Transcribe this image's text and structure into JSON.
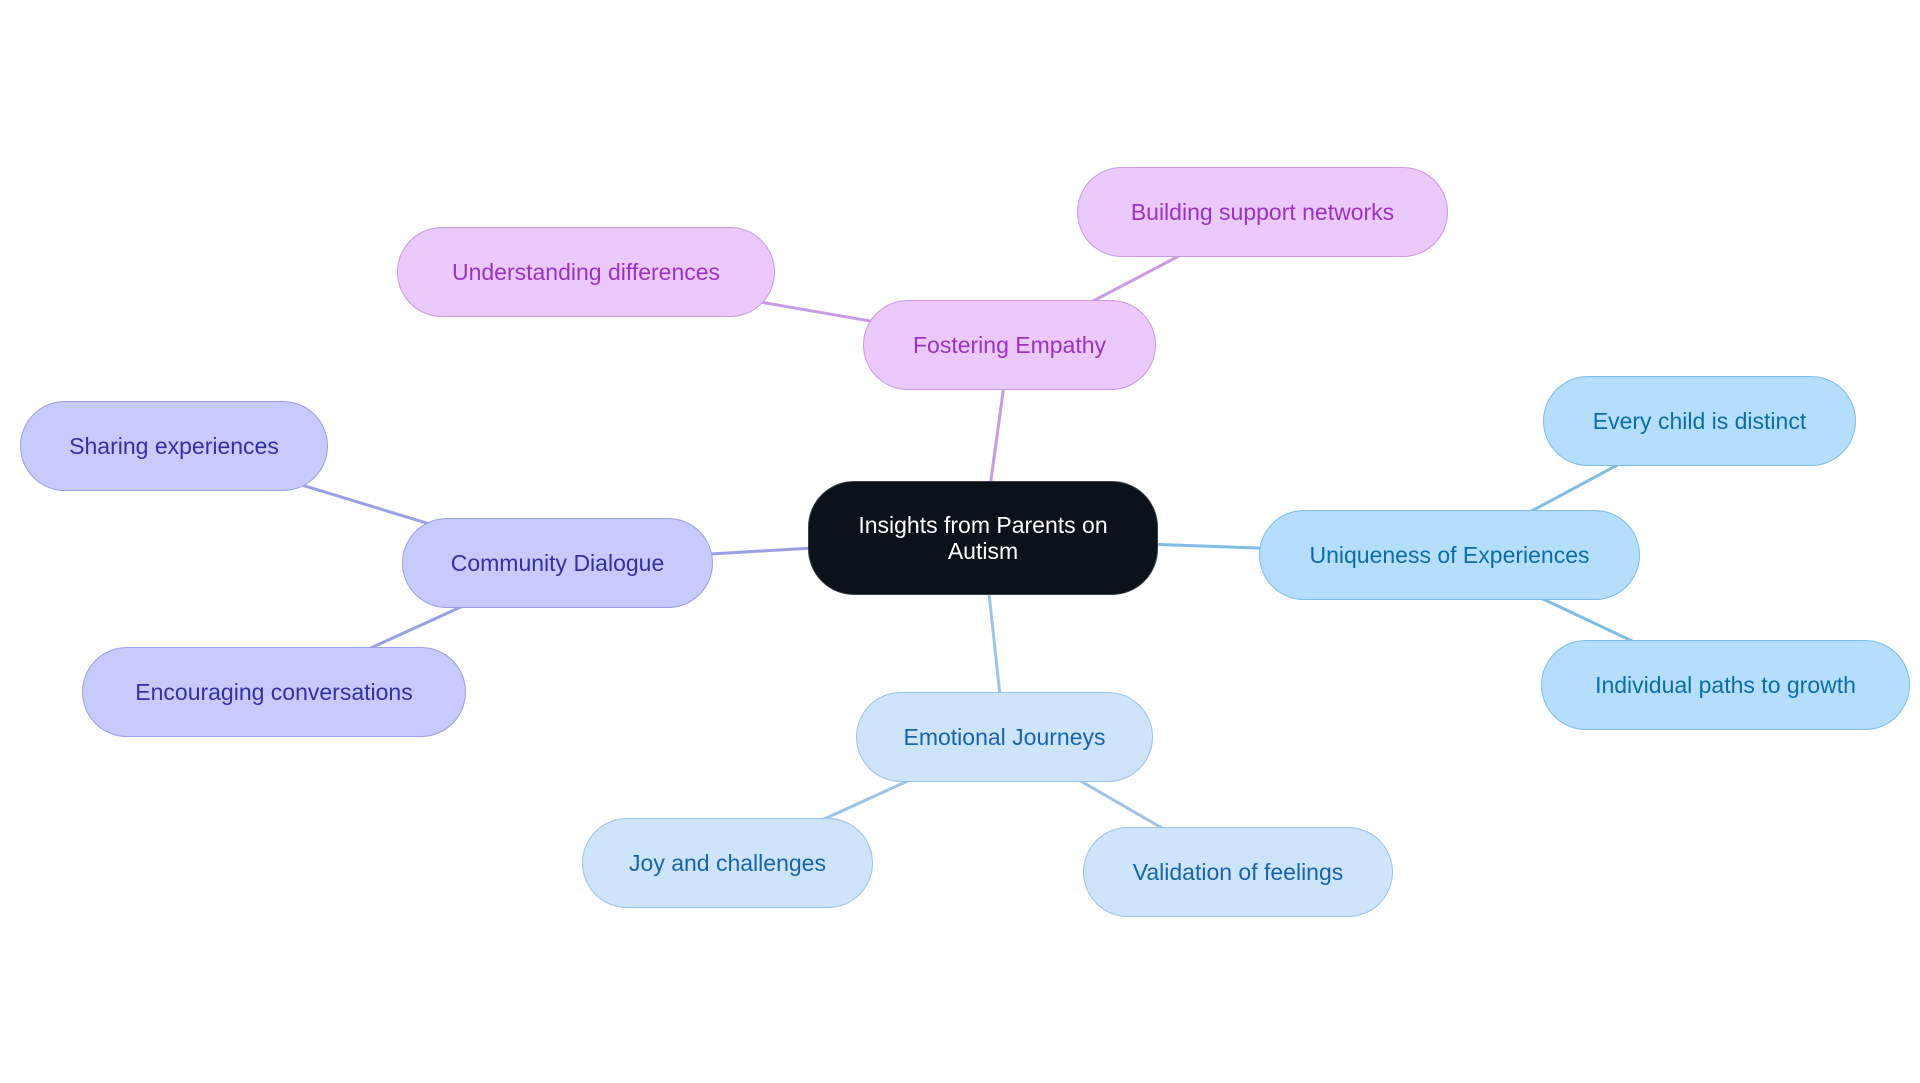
{
  "diagram": {
    "type": "mindmap",
    "root": {
      "id": "root",
      "label": "Insights from Parents on Autism"
    },
    "branches": [
      {
        "id": "empathy",
        "label": "Fostering Empathy",
        "theme": "purple",
        "children": [
          {
            "id": "differences",
            "label": "Understanding differences"
          },
          {
            "id": "networks",
            "label": "Building support networks"
          }
        ]
      },
      {
        "id": "uniqueness",
        "label": "Uniqueness of Experiences",
        "theme": "sky",
        "children": [
          {
            "id": "distinct",
            "label": "Every child is distinct"
          },
          {
            "id": "growth",
            "label": "Individual paths to growth"
          }
        ]
      },
      {
        "id": "emotional",
        "label": "Emotional Journeys",
        "theme": "light",
        "children": [
          {
            "id": "joy",
            "label": "Joy and challenges"
          },
          {
            "id": "validation",
            "label": "Validation of feelings"
          }
        ]
      },
      {
        "id": "community",
        "label": "Community Dialogue",
        "theme": "indigo",
        "children": [
          {
            "id": "sharing",
            "label": "Sharing experiences"
          },
          {
            "id": "conversations",
            "label": "Encouraging conversations"
          }
        ]
      }
    ],
    "colors": {
      "root_fill": "#0c1219",
      "purple": {
        "fill": "#ebc9fd",
        "text": "#9a32c6",
        "edge": "#c99ae6"
      },
      "sky": {
        "fill": "#b5defc",
        "text": "#0b6ea8",
        "edge": "#7fbde6"
      },
      "light": {
        "fill": "#cde4fb",
        "text": "#1764ae",
        "edge": "#9dc3e8"
      },
      "indigo": {
        "fill": "#c7cafd",
        "text": "#3330a6",
        "edge": "#9c9ee6"
      }
    }
  }
}
